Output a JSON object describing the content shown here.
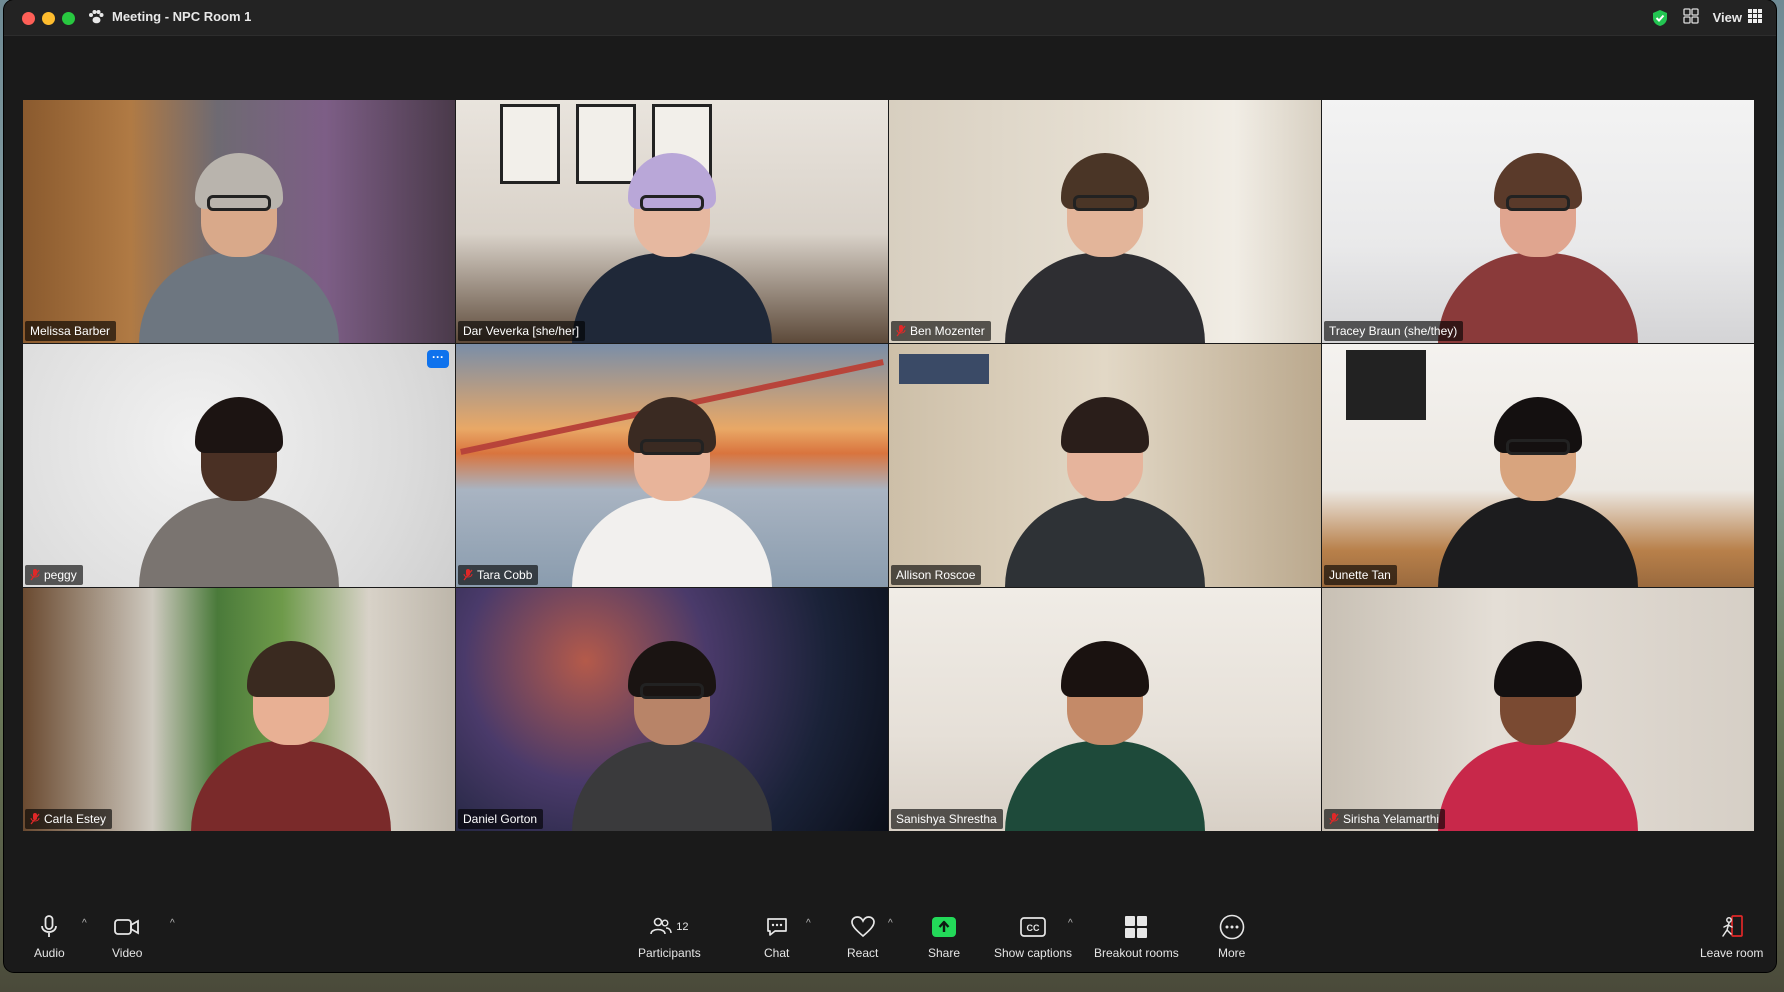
{
  "window": {
    "title": "Meeting - NPC Room 1",
    "view_label": "View"
  },
  "participants": [
    {
      "name": "Melissa Barber",
      "muted": false
    },
    {
      "name": "Dar Veverka [she/her]",
      "muted": false
    },
    {
      "name": "Ben Mozenter",
      "muted": true
    },
    {
      "name": "Tracey Braun (she/they)",
      "muted": false
    },
    {
      "name": "peggy",
      "muted": true,
      "has_menu": true
    },
    {
      "name": "Tara Cobb",
      "muted": true
    },
    {
      "name": "Allison Roscoe",
      "muted": false,
      "active_speaker": true
    },
    {
      "name": "Junette Tan",
      "muted": false
    },
    {
      "name": "Carla Estey",
      "muted": true
    },
    {
      "name": "Daniel Gorton",
      "muted": false
    },
    {
      "name": "Sanishya Shrestha",
      "muted": false
    },
    {
      "name": "Sirisha Yelamarthi",
      "muted": true
    }
  ],
  "tile_menu_label": "···",
  "toolbar": {
    "audio": "Audio",
    "video": "Video",
    "participants": "Participants",
    "participants_count": "12",
    "chat": "Chat",
    "react": "React",
    "share": "Share",
    "captions": "Show captions",
    "breakout": "Breakout rooms",
    "more": "More",
    "leave": "Leave room"
  },
  "colors": {
    "active_speaker": "#23d959",
    "share_green": "#23d959",
    "menu_blue": "#0e72ed",
    "mute_red": "#e02828"
  }
}
